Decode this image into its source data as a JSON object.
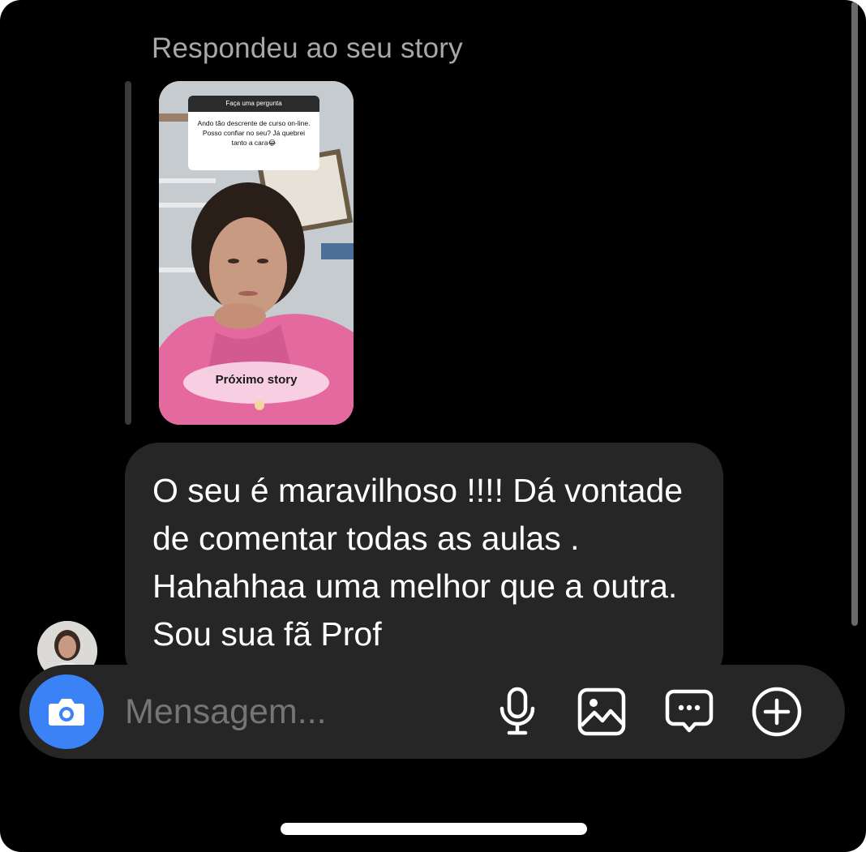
{
  "reply": {
    "header": "Respondeu ao seu story"
  },
  "story": {
    "question_title": "Faça uma pergunta",
    "question_text": "Ando tão descrente de curso on-line. Posso confiar no seu? Já quebrei tanto a cara😂",
    "next_label": "Próximo story"
  },
  "message": {
    "text": "O seu é maravilhoso !!!! Dá vontade de comentar todas as aulas . Hahahhaa uma melhor que a outra. Sou sua fã Prof"
  },
  "composer": {
    "placeholder": "Mensagem...",
    "camera_icon": "camera-icon",
    "mic_icon": "microphone-icon",
    "gallery_icon": "image-icon",
    "sticker_icon": "chat-bubble-icon",
    "plus_icon": "plus-circle-icon"
  },
  "colors": {
    "background": "#000000",
    "bubble": "#262626",
    "accent": "#3b82f6",
    "secondary_text": "#a8a8a8"
  }
}
